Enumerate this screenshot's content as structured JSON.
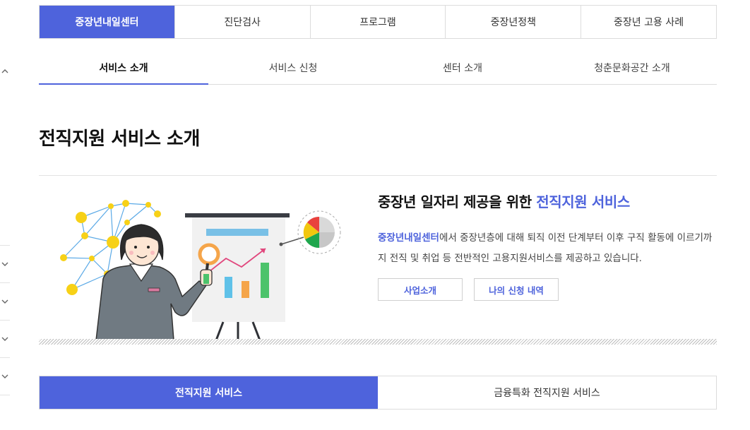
{
  "top_tabs": [
    {
      "label": "중장년내일센터",
      "active": true
    },
    {
      "label": "진단검사",
      "active": false
    },
    {
      "label": "프로그램",
      "active": false
    },
    {
      "label": "중장년정책",
      "active": false
    },
    {
      "label": "중장년 고용 사례",
      "active": false
    }
  ],
  "sub_tabs": [
    {
      "label": "서비스 소개",
      "active": true
    },
    {
      "label": "서비스 신청",
      "active": false
    },
    {
      "label": "센터 소개",
      "active": false
    },
    {
      "label": "청춘문화공간 소개",
      "active": false
    }
  ],
  "page_title": "전직지원 서비스 소개",
  "intro": {
    "heading_prefix": "중장년 일자리 제공을 위한 ",
    "heading_highlight": "전직지원 서비스",
    "desc_highlight": "중장년내일센터",
    "desc_rest": "에서 중장년층에 대해 퇴직 이전 단계부터 이후 구직 활동에 이르기까지 전직 및 취업 등 전반적인 고용지원서비스를 제공하고 있습니다."
  },
  "buttons": {
    "about": "사업소개",
    "history": "나의 신청 내역"
  },
  "bottom_tabs": [
    {
      "label": "전직지원 서비스",
      "active": true
    },
    {
      "label": "금융특화 전직지원 서비스",
      "active": false
    }
  ],
  "colors": {
    "accent": "#4e63dc",
    "node_yellow": "#f7d117",
    "network_blue": "#5aa9e6"
  },
  "icons": {
    "rail_up": "chevron-up-icon",
    "rail_down": "chevron-down-icon"
  }
}
